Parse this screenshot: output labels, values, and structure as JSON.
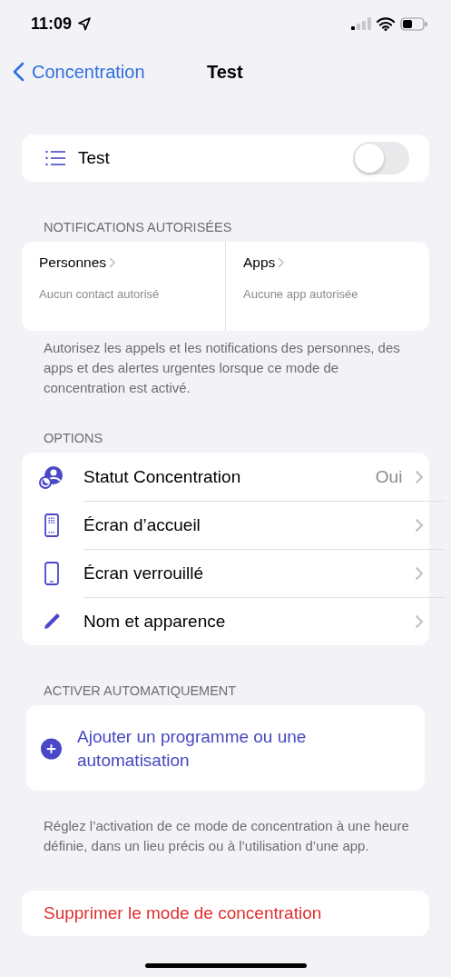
{
  "status_bar": {
    "time": "11:09"
  },
  "nav": {
    "back": "Concentration",
    "title": "Test"
  },
  "focus": {
    "label": "Test",
    "on": false
  },
  "notifications": {
    "header": "NOTIFICATIONS AUTORISÉES",
    "columns": [
      {
        "title": "Personnes",
        "subtitle": "Aucun contact autorisé"
      },
      {
        "title": "Apps",
        "subtitle": "Aucune app autorisée"
      }
    ],
    "footer": "Autorisez les appels et les notifications des personnes, des apps et des alertes urgentes lorsque ce mode de concentration est activé."
  },
  "options": {
    "header": "OPTIONS",
    "items": [
      {
        "kind": "status",
        "label": "Statut Concentration",
        "value": "Oui"
      },
      {
        "kind": "home",
        "label": "Écran d’accueil"
      },
      {
        "kind": "lock",
        "label": "Écran verrouillé"
      },
      {
        "kind": "name",
        "label": "Nom et apparence"
      }
    ]
  },
  "automation": {
    "header": "ACTIVER AUTOMATIQUEMENT",
    "add": "Ajouter un programme ou une automatisation",
    "footer": "Réglez l’activation de ce mode de concentration à une heure définie, dans un lieu précis ou à l’utilisation d’une app."
  },
  "delete": "Supprimer le mode de concentration"
}
